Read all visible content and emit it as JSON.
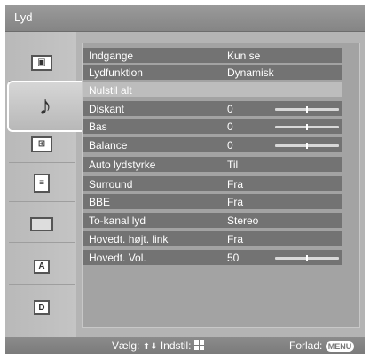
{
  "window": {
    "title": "Lyd"
  },
  "sidebar": {
    "items": [
      {
        "icon": "picture-icon",
        "glyph": "⊡"
      },
      {
        "icon": "sound-note-icon",
        "glyph": "♪"
      },
      {
        "icon": "screen-icon",
        "glyph": "⊞"
      },
      {
        "icon": "setup-list-icon",
        "glyph": "≡"
      },
      {
        "icon": "pc-monitor-icon",
        "glyph": "▭"
      },
      {
        "icon": "analog-channel-icon",
        "glyph": "A"
      },
      {
        "icon": "digital-channel-icon",
        "glyph": "D"
      }
    ]
  },
  "menu": {
    "rows": [
      {
        "label": "Indgange",
        "value": "Kun se"
      },
      {
        "label": "Lydfunktion",
        "value": "Dynamisk"
      },
      {
        "label": "Nulstil alt",
        "value": ""
      },
      {
        "label": "Diskant",
        "value": "0",
        "slider": 0.5
      },
      {
        "label": "Bas",
        "value": "0",
        "slider": 0.5
      },
      {
        "label": "Balance",
        "value": "0",
        "slider": 0.5
      },
      {
        "label": "Auto lydstyrke",
        "value": "Til"
      },
      {
        "label": "Surround",
        "value": "Fra"
      },
      {
        "label": "BBE",
        "value": "Fra"
      },
      {
        "label": "To-kanal lyd",
        "value": "Stereo"
      },
      {
        "label": "Hovedt. højt. link",
        "value": "Fra"
      },
      {
        "label": "Hovedt. Vol.",
        "value": "50",
        "slider": 0.5
      }
    ]
  },
  "footer": {
    "select_label": "Vælg:",
    "select_arrows": "⬆⬇",
    "set_label": "Indstil:",
    "exit_label": "Forlad:",
    "menu_key": "MENU"
  },
  "colors": {
    "row_bg": "#737373",
    "row_highlight": "#bdbdbd",
    "panel_bg": "#a3a3a3"
  }
}
